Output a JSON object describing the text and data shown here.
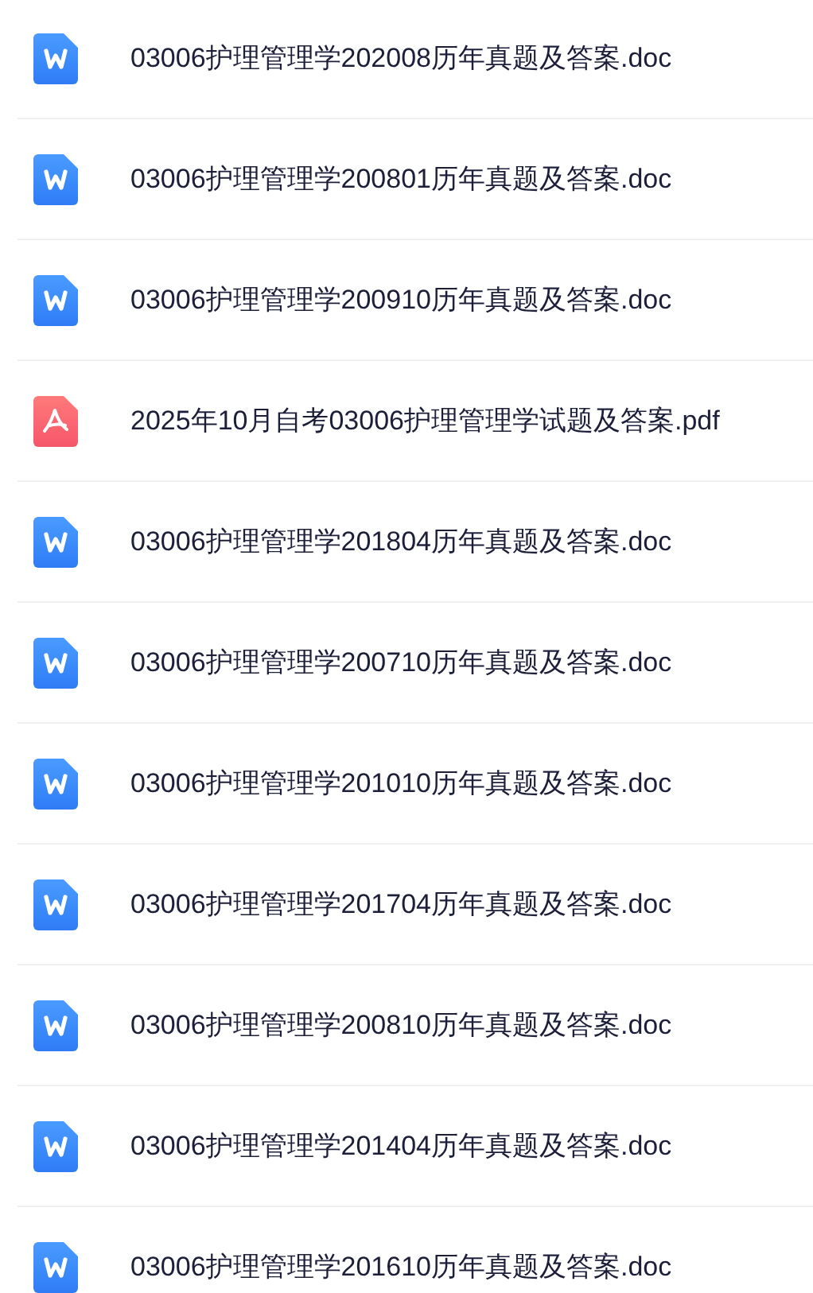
{
  "files": [
    {
      "kind": "doc",
      "name": "03006护理管理学202008历年真题及答案.doc"
    },
    {
      "kind": "doc",
      "name": "03006护理管理学200801历年真题及答案.doc"
    },
    {
      "kind": "doc",
      "name": "03006护理管理学200910历年真题及答案.doc"
    },
    {
      "kind": "pdf",
      "name": "2025年10月自考03006护理管理学试题及答案.pdf"
    },
    {
      "kind": "doc",
      "name": "03006护理管理学201804历年真题及答案.doc"
    },
    {
      "kind": "doc",
      "name": "03006护理管理学200710历年真题及答案.doc"
    },
    {
      "kind": "doc",
      "name": "03006护理管理学201010历年真题及答案.doc"
    },
    {
      "kind": "doc",
      "name": "03006护理管理学201704历年真题及答案.doc"
    },
    {
      "kind": "doc",
      "name": "03006护理管理学200810历年真题及答案.doc"
    },
    {
      "kind": "doc",
      "name": "03006护理管理学201404历年真题及答案.doc"
    },
    {
      "kind": "doc",
      "name": "03006护理管理学201610历年真题及答案.doc"
    }
  ]
}
